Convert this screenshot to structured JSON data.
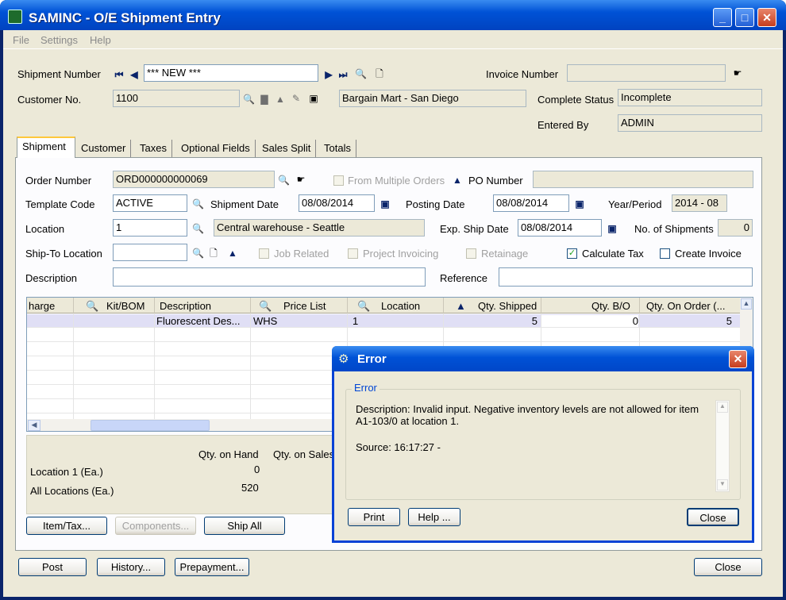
{
  "window": {
    "title": "SAMINC - O/E Shipment Entry",
    "min": "_",
    "max": "□",
    "close": "✕"
  },
  "menu": [
    "File",
    "Settings",
    "Help"
  ],
  "header": {
    "shipment_number_label": "Shipment Number",
    "shipment_number": "*** NEW ***",
    "invoice_number_label": "Invoice Number",
    "invoice_number": "",
    "customer_no_label": "Customer No.",
    "customer_no": "1100",
    "customer_name": "Bargain Mart - San Diego",
    "complete_status_label": "Complete Status",
    "complete_status": "Incomplete",
    "entered_by_label": "Entered By",
    "entered_by": "ADMIN"
  },
  "tabs": [
    "Shipment",
    "Customer",
    "Taxes",
    "Optional Fields",
    "Sales Split",
    "Totals"
  ],
  "shipment": {
    "order_number_label": "Order Number",
    "order_number": "ORD000000000069",
    "from_multiple_orders": "From Multiple Orders",
    "po_number_label": "PO Number",
    "po_number": "",
    "template_code_label": "Template Code",
    "template_code": "ACTIVE",
    "shipment_date_label": "Shipment Date",
    "shipment_date": "08/08/2014",
    "posting_date_label": "Posting Date",
    "posting_date": "08/08/2014",
    "year_period_label": "Year/Period",
    "year_period": "2014 - 08",
    "location_label": "Location",
    "location": "1",
    "location_name": "Central warehouse - Seattle",
    "exp_ship_date_label": "Exp. Ship Date",
    "exp_ship_date": "08/08/2014",
    "no_shipments_label": "No. of Shipments",
    "no_shipments": "0",
    "ship_to_label": "Ship-To Location",
    "ship_to": "",
    "job_related": "Job Related",
    "project_invoicing": "Project Invoicing",
    "retainage": "Retainage",
    "calculate_tax": "Calculate Tax",
    "create_invoice": "Create Invoice",
    "description_label": "Description",
    "description": "",
    "reference_label": "Reference",
    "reference": ""
  },
  "grid": {
    "columns": [
      "harge",
      "Kit/BOM",
      "Description",
      "Price List",
      "Location",
      "Qty. Shipped",
      "Qty. B/O",
      "Qty. On Order (..."
    ],
    "rows": [
      {
        "description": "Fluorescent Des...",
        "price_list": "WHS",
        "location": "1",
        "qty_shipped": "5",
        "qty_bo": "0",
        "qty_on_order": "5"
      }
    ]
  },
  "summary": {
    "qty_on_hand_label": "Qty. on Hand",
    "qty_on_sales_label": "Qty. on Sales",
    "location_label": "Location  1 (Ea.)",
    "location_qty": "0",
    "all_locations_label": "All Locations (Ea.)",
    "all_locations_qty": "520"
  },
  "buttons": {
    "item_tax": "Item/Tax...",
    "components": "Components...",
    "ship_all": "Ship All",
    "post": "Post",
    "history": "History...",
    "prepayment": "Prepayment...",
    "close": "Close"
  },
  "error": {
    "title": "Error",
    "group_label": "Error",
    "description": "Description: Invalid input. Negative inventory levels are not allowed for item A1-103/0 at location 1.",
    "source": "Source:  16:17:27 -",
    "print": "Print",
    "help": "Help ...",
    "close": "Close"
  }
}
